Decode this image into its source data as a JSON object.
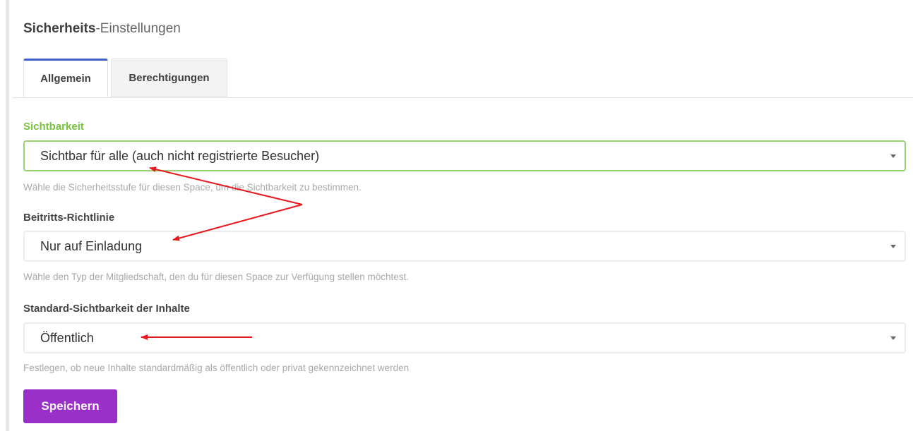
{
  "heading": {
    "strong": "Sicherheits",
    "light": "-Einstellungen"
  },
  "tabs": [
    {
      "label": "Allgemein",
      "active": true
    },
    {
      "label": "Berechtigungen",
      "active": false
    }
  ],
  "fields": {
    "visibility": {
      "label": "Sichtbarkeit",
      "value": "Sichtbar für alle (auch nicht registrierte Besucher)",
      "help": "Wähle die Sicherheitsstufe für diesen Space, um die Sichtbarkeit zu bestimmen."
    },
    "join_policy": {
      "label": "Beitritts-Richtlinie",
      "value": "Nur auf Einladung",
      "help": "Wähle den Typ der Mitgliedschaft, den du für diesen Space zur Verfügung stellen möchtest."
    },
    "content_visibility": {
      "label": "Standard-Sichtbarkeit der Inhalte",
      "value": "Öffentlich",
      "help": "Festlegen, ob neue Inhalte standardmäßig als öffentlich oder privat gekennzeichnet werden"
    }
  },
  "save_button": "Speichern",
  "colors": {
    "accent_tab": "#3d5fc7",
    "label_active": "#7ac143",
    "focus_border": "#98d16f",
    "button": "#9b30c9",
    "annotation_arrow": "#e8191e"
  }
}
